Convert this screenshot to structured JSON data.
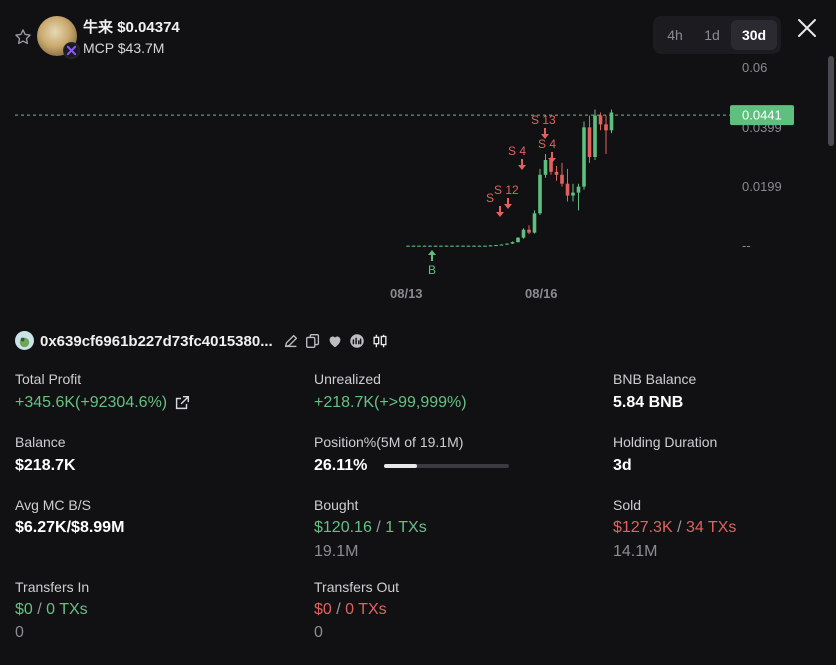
{
  "header": {
    "token_name": "牛来",
    "price": "$0.04374",
    "mcp": "MCP $43.7M",
    "timeframes": [
      "4h",
      "1d",
      "30d"
    ],
    "active_timeframe": "30d"
  },
  "chart_data": {
    "type": "candlestick",
    "x_ticks": [
      "08/13",
      "08/16"
    ],
    "y_ticks": [
      "0.06",
      "0.0399",
      "0.0199",
      "--"
    ],
    "current_price_label": "0.0441",
    "current_price": 0.0441,
    "ylim": [
      0,
      0.06
    ],
    "markers": [
      {
        "label": "B",
        "kind": "buy"
      },
      {
        "label": "S 12",
        "kind": "sell"
      },
      {
        "label": "S",
        "kind": "sell"
      },
      {
        "label": "S 4",
        "kind": "sell"
      },
      {
        "label": "S 13",
        "kind": "sell"
      },
      {
        "label": "S 4",
        "kind": "sell"
      }
    ],
    "candles": [
      {
        "o": 0.0001,
        "h": 0.0002,
        "l": 0.0001,
        "c": 0.0001
      },
      {
        "o": 0.0001,
        "h": 0.0002,
        "l": 0.0001,
        "c": 0.0001
      },
      {
        "o": 0.0001,
        "h": 0.0002,
        "l": 0.0001,
        "c": 0.0001
      },
      {
        "o": 0.0001,
        "h": 0.0002,
        "l": 0.0001,
        "c": 0.0001
      },
      {
        "o": 0.0001,
        "h": 0.0002,
        "l": 0.0001,
        "c": 0.0001
      },
      {
        "o": 0.0001,
        "h": 0.0002,
        "l": 0.0001,
        "c": 0.0001
      },
      {
        "o": 0.0001,
        "h": 0.0002,
        "l": 0.0001,
        "c": 0.0001
      },
      {
        "o": 0.0001,
        "h": 0.0002,
        "l": 0.0001,
        "c": 0.0001
      },
      {
        "o": 0.0001,
        "h": 0.0002,
        "l": 0.0001,
        "c": 0.0001
      },
      {
        "o": 0.0001,
        "h": 0.0002,
        "l": 0.0001,
        "c": 0.0001
      },
      {
        "o": 0.0001,
        "h": 0.0002,
        "l": 0.0001,
        "c": 0.0001
      },
      {
        "o": 0.0001,
        "h": 0.0002,
        "l": 0.0001,
        "c": 0.0001
      },
      {
        "o": 0.0001,
        "h": 0.0002,
        "l": 0.0001,
        "c": 0.0001
      },
      {
        "o": 0.0001,
        "h": 0.0002,
        "l": 0.0001,
        "c": 0.0001
      },
      {
        "o": 0.0001,
        "h": 0.0002,
        "l": 0.0001,
        "c": 0.0001
      },
      {
        "o": 0.0001,
        "h": 0.0003,
        "l": 0.0001,
        "c": 0.0002
      },
      {
        "o": 0.0002,
        "h": 0.0004,
        "l": 0.0001,
        "c": 0.0003
      },
      {
        "o": 0.0003,
        "h": 0.0006,
        "l": 0.0002,
        "c": 0.0005
      },
      {
        "o": 0.0005,
        "h": 0.0009,
        "l": 0.0004,
        "c": 0.0008
      },
      {
        "o": 0.0008,
        "h": 0.0015,
        "l": 0.0007,
        "c": 0.0013
      },
      {
        "o": 0.0013,
        "h": 0.003,
        "l": 0.0012,
        "c": 0.0028
      },
      {
        "o": 0.0028,
        "h": 0.006,
        "l": 0.0025,
        "c": 0.0055
      },
      {
        "o": 0.0055,
        "h": 0.007,
        "l": 0.004,
        "c": 0.0045
      },
      {
        "o": 0.0045,
        "h": 0.012,
        "l": 0.0042,
        "c": 0.011
      },
      {
        "o": 0.011,
        "h": 0.026,
        "l": 0.0105,
        "c": 0.024
      },
      {
        "o": 0.024,
        "h": 0.031,
        "l": 0.023,
        "c": 0.029
      },
      {
        "o": 0.029,
        "h": 0.03,
        "l": 0.024,
        "c": 0.025
      },
      {
        "o": 0.025,
        "h": 0.027,
        "l": 0.022,
        "c": 0.024
      },
      {
        "o": 0.024,
        "h": 0.028,
        "l": 0.02,
        "c": 0.021
      },
      {
        "o": 0.021,
        "h": 0.026,
        "l": 0.015,
        "c": 0.017
      },
      {
        "o": 0.017,
        "h": 0.021,
        "l": 0.015,
        "c": 0.018
      },
      {
        "o": 0.018,
        "h": 0.021,
        "l": 0.012,
        "c": 0.02
      },
      {
        "o": 0.02,
        "h": 0.042,
        "l": 0.019,
        "c": 0.04
      },
      {
        "o": 0.04,
        "h": 0.044,
        "l": 0.028,
        "c": 0.03
      },
      {
        "o": 0.03,
        "h": 0.046,
        "l": 0.029,
        "c": 0.044
      },
      {
        "o": 0.044,
        "h": 0.045,
        "l": 0.039,
        "c": 0.041
      },
      {
        "o": 0.041,
        "h": 0.044,
        "l": 0.031,
        "c": 0.039
      },
      {
        "o": 0.039,
        "h": 0.046,
        "l": 0.038,
        "c": 0.045
      }
    ]
  },
  "wallet": {
    "address": "0x639cf6961b227d73fc4015380..."
  },
  "stats": {
    "total_profit_label": "Total Profit",
    "total_profit_value": "+345.6K(+92304.6%)",
    "unrealized_label": "Unrealized",
    "unrealized_value": "+218.7K(+>99,999%)",
    "bnb_balance_label": "BNB Balance",
    "bnb_balance_value": "5.84 BNB",
    "balance_label": "Balance",
    "balance_value": "$218.7K",
    "position_label": "Position%(5M of 19.1M)",
    "position_value": "26.11%",
    "position_fraction": 0.2611,
    "holding_label": "Holding Duration",
    "holding_value": "3d",
    "avg_mc_label": "Avg MC B/S",
    "avg_mc_value": "$6.27K/$8.99M",
    "bought_label": "Bought",
    "bought_amount": "$120.16",
    "bought_txs": "1 TXs",
    "bought_tokens": "19.1M",
    "sold_label": "Sold",
    "sold_amount": "$127.3K",
    "sold_txs": "34 TXs",
    "sold_tokens": "14.1M",
    "transfers_in_label": "Transfers In",
    "transfers_in_amount": "$0",
    "transfers_in_txs": "0 TXs",
    "transfers_in_tokens": "0",
    "transfers_out_label": "Transfers Out",
    "transfers_out_amount": "$0",
    "transfers_out_txs": "0 TXs",
    "transfers_out_tokens": "0",
    "separator": "/"
  },
  "colors": {
    "up": "#5fbf7f",
    "down": "#e0625f",
    "price_tag": "#5fbf7f",
    "background": "#111113"
  }
}
